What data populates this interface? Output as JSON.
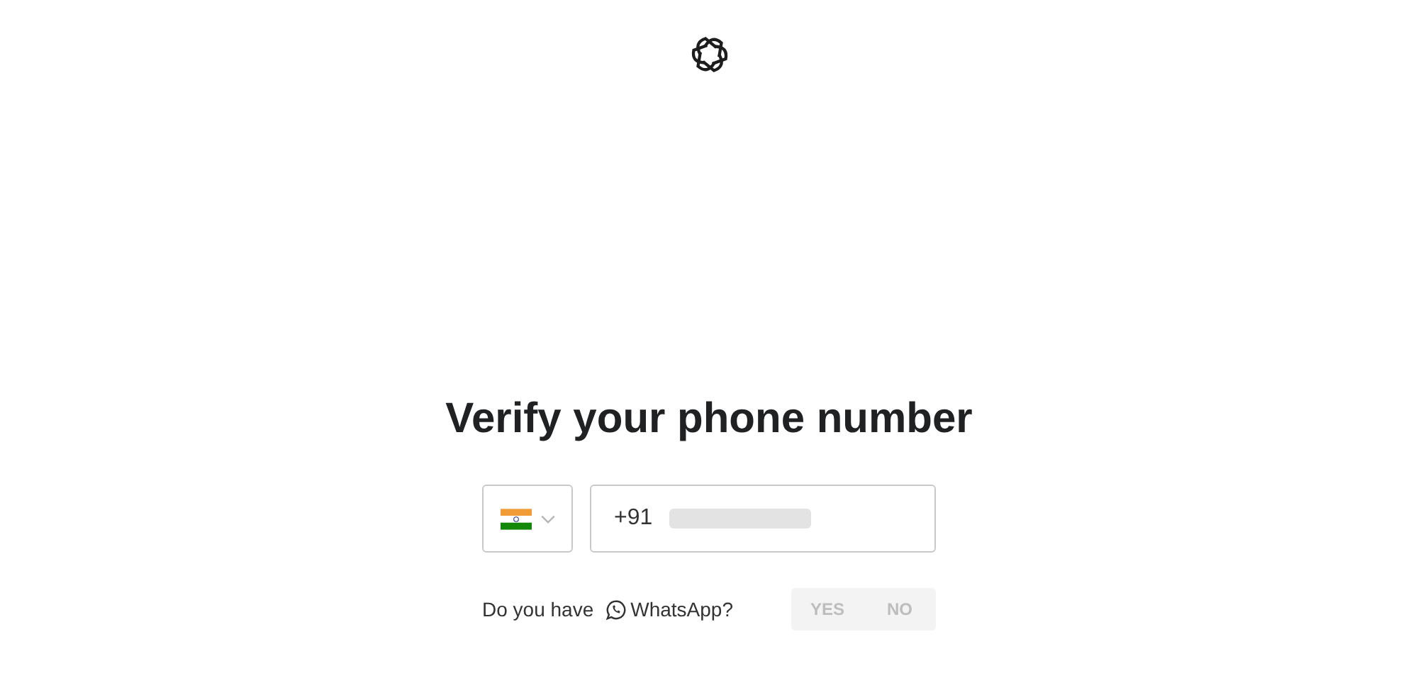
{
  "title": "Verify your phone number",
  "country_select": {
    "kind": "india"
  },
  "phone_field": {
    "prefix": "+91",
    "redacted": true
  },
  "whatsapp_question": {
    "before": "Do you have",
    "app": "WhatsApp?"
  },
  "answer_options": [
    {
      "label": "YES",
      "selected": false
    },
    {
      "label": "NO",
      "selected": false
    }
  ]
}
